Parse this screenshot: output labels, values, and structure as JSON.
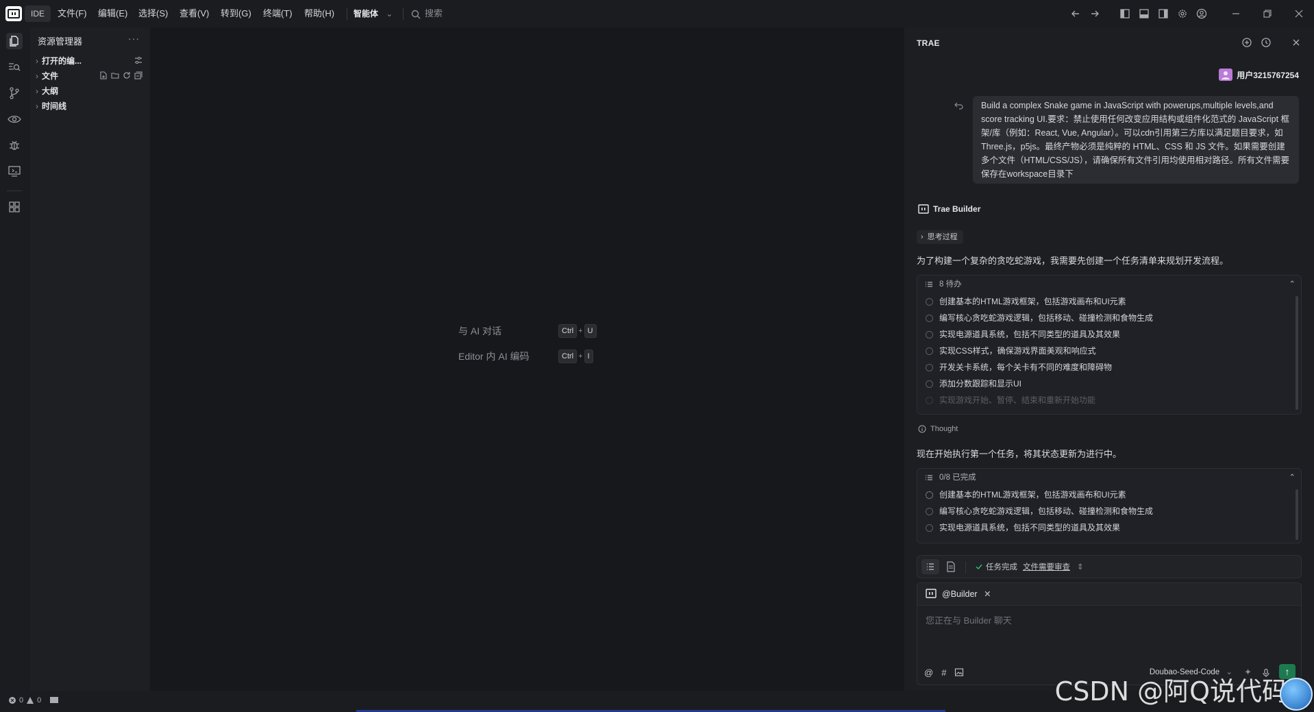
{
  "titlebar": {
    "ide_label": "IDE",
    "menu": [
      "文件(F)",
      "编辑(E)",
      "选择(S)",
      "查看(V)",
      "转到(G)",
      "终端(T)",
      "帮助(H)"
    ],
    "agent_mode": "智能体",
    "search_label": "搜索"
  },
  "sidebar": {
    "title": "资源管理器",
    "sections": [
      {
        "label": "打开的编..."
      },
      {
        "label": "文件"
      },
      {
        "label": "大纲"
      },
      {
        "label": "时间线"
      }
    ]
  },
  "editor": {
    "hints": [
      {
        "label": "与 AI 对话",
        "keys": [
          "Ctrl",
          "U"
        ]
      },
      {
        "label": "Editor 内 AI 编码",
        "keys": [
          "Ctrl",
          "I"
        ]
      }
    ],
    "plus": "+"
  },
  "chat": {
    "title": "TRAE",
    "user_name": "用户3215767254",
    "user_message": "Build a complex Snake game in JavaScript with powerups,multiple levels,and score tracking UI.要求：禁止使用任何改变应用结构或组件化范式的 JavaScript 框架/库（例如：React, Vue, Angular）。可以cdn引用第三方库以满足题目要求，如Three.js，p5js。最终产物必须是纯粹的 HTML、CSS 和 JS 文件。如果需要创建多个文件（HTML/CSS/JS），请确保所有文件引用均使用相对路径。所有文件需要保存在workspace目录下",
    "bot_name": "Trae Builder",
    "thinking_label": "思考过程",
    "bot_text_1": "为了构建一个复杂的贪吃蛇游戏，我需要先创建一个任务清单来规划开发流程。",
    "todo1": {
      "header": "8 待办",
      "items": [
        "创建基本的HTML游戏框架，包括游戏画布和UI元素",
        "编写核心贪吃蛇游戏逻辑，包括移动、碰撞检测和食物生成",
        "实现电源道具系统，包括不同类型的道具及其效果",
        "实现CSS样式，确保游戏界面美观和响应式",
        "开发关卡系统，每个关卡有不同的难度和障碍物",
        "添加分数跟踪和显示UI",
        "实现游戏开始、暂停、结束和重新开始功能"
      ]
    },
    "thought_label": "Thought",
    "bot_text_2": "现在开始执行第一个任务，将其状态更新为进行中。",
    "todo2": {
      "header": "0/8 已完成",
      "items": [
        "创建基本的HTML游戏框架，包括游戏画布和UI元素",
        "编写核心贪吃蛇游戏逻辑，包括移动、碰撞检测和食物生成",
        "实现电源道具系统，包括不同类型的道具及其效果"
      ]
    },
    "task_status": "任务完成",
    "task_review": "文件需要审查",
    "input_tag": "@Builder",
    "input_placeholder": "您正在与 Builder 聊天",
    "model": "Doubao-Seed-Code"
  },
  "statusbar": {
    "errors": "0",
    "warnings": "0"
  },
  "watermark": "CSDN @阿Q说代码"
}
